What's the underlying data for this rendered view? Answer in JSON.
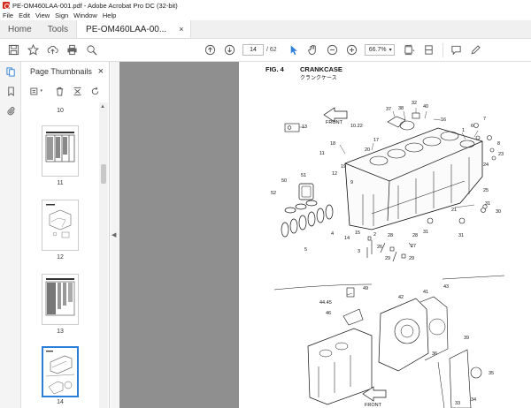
{
  "window": {
    "title": "PE-OM460LAA-001.pdf - Adobe Acrobat Pro DC (32-bit)"
  },
  "menu": [
    "File",
    "Edit",
    "View",
    "Sign",
    "Window",
    "Help"
  ],
  "tabs": {
    "home": "Home",
    "tools": "Tools",
    "document": "PE-OM460LAA-00...",
    "close": "×"
  },
  "toolbar": {
    "page_current": "14",
    "page_total": "/ 62",
    "zoom": "66.7%"
  },
  "thumbnails": {
    "title": "Page Thumbnails",
    "close": "×",
    "pages": [
      "10",
      "11",
      "12",
      "13",
      "14"
    ],
    "selected": "14"
  },
  "figure": {
    "fig_label": "FIG. 4",
    "name": "CRANKCASE",
    "subtitle": "クランクケース",
    "front_top": "FRONT",
    "front_bottom": "FRONT",
    "callouts": [
      "37",
      "38",
      "32",
      "40",
      "16",
      "1",
      "6",
      "7",
      "10.22",
      "13",
      "17",
      "18",
      "20",
      "11",
      "19",
      "12",
      "8",
      "23",
      "24",
      "9",
      "51",
      "50",
      "52",
      "25",
      "21",
      "31",
      "30",
      "4",
      "15",
      "14",
      "2",
      "28",
      "28",
      "31",
      "31",
      "5",
      "26",
      "27",
      "3",
      "29",
      "29",
      "49",
      "44.45",
      "46",
      "42",
      "41",
      "43",
      "39",
      "36",
      "35",
      "34",
      "33"
    ]
  },
  "colors": {
    "accent": "#2d7ed8",
    "acrobat_red": "#d42b1e",
    "doc_bg": "#8f8f8f"
  }
}
